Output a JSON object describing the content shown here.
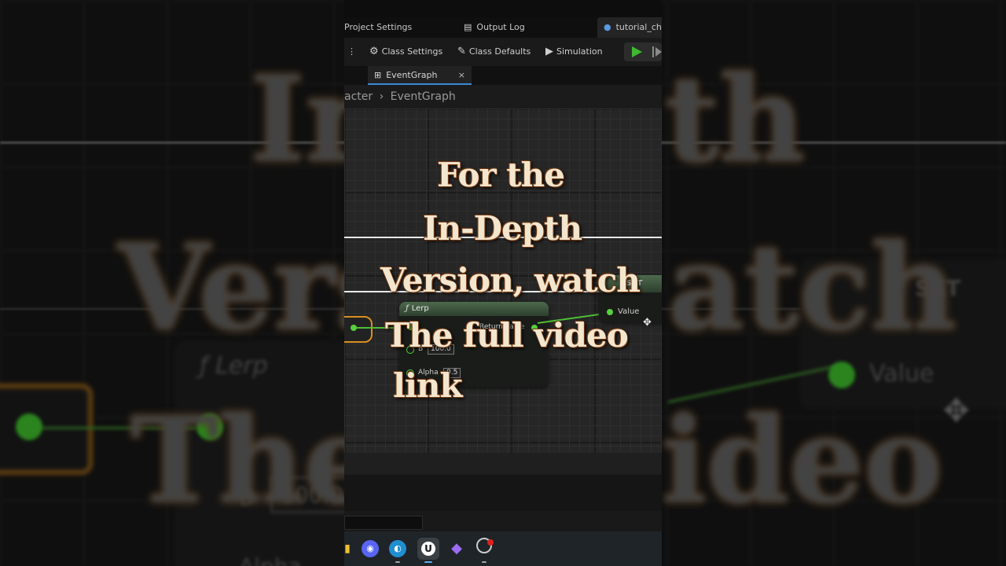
{
  "editor": {
    "tabs": {
      "project_settings": "Project Settings",
      "output_log": "Output Log",
      "asset_tab": "tutorial_cha"
    },
    "toolbar": {
      "class_settings": "Class Settings",
      "class_defaults": "Class Defaults",
      "simulation": "Simulation"
    },
    "graph_tab": {
      "label": "EventGraph",
      "close": "×"
    },
    "breadcrumb": {
      "parent": "acter",
      "separator": "›",
      "current": "EventGraph"
    },
    "nodes": {
      "lerp": {
        "title": "Lerp",
        "fx": "ƒ",
        "return_label": "Return Value",
        "b_label": "B",
        "b_value": "100.0",
        "alpha_label": "Alpha",
        "alpha_value": "0.5"
      },
      "set": {
        "title": "SET",
        "value_label": "Value"
      }
    }
  },
  "caption": {
    "line1": "For the",
    "line2": "In-Depth",
    "line3": "Version, watch",
    "line4": "The full video",
    "line5": "link"
  },
  "background_blur": {
    "title_fragment": "In",
    "depth_fragment": "th",
    "version_fragment": "Vers",
    "watch_fragment": "atch",
    "the_fragment": "The",
    "video_fragment": "ideo",
    "lerp_label": "Lerp",
    "set_label": "SET",
    "value_label": "Value",
    "b_label": "B",
    "b_value": "100.0",
    "alpha_label": "Alpha"
  },
  "taskbar": {
    "icons": [
      "folder-icon",
      "discord-icon",
      "edge-icon",
      "unreal-icon",
      "obsidian-icon",
      "app-icon"
    ]
  },
  "colors": {
    "accent_green": "#56d13c",
    "accent_blue": "#3a8ad6",
    "exec_orange": "#d98f1f",
    "caption_text": "#f3e6cf"
  }
}
